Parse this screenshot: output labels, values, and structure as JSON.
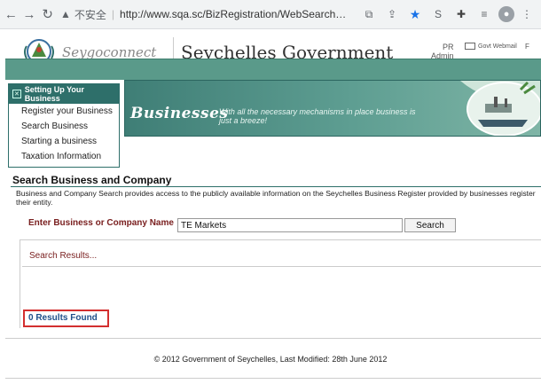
{
  "browser": {
    "insecure_label": "不安全",
    "url": "http://www.sqa.sc/BizRegistration/WebSearchBusi...",
    "icons": [
      "back-icon",
      "forward-icon",
      "reload-icon",
      "warning-icon",
      "translate-icon",
      "share-icon",
      "star-icon",
      "extension-icon",
      "puzzle-icon",
      "reading-list-icon",
      "profile-icon",
      "menu-icon"
    ],
    "back_glyph": "←",
    "forward_glyph": "→",
    "reload_glyph": "↻",
    "warning_glyph": "▲",
    "translate_glyph": "⧉",
    "share_glyph": "⇪",
    "star_glyph": "★",
    "ext_glyph": "S",
    "puzzle_glyph": "✚",
    "list_glyph": "≡",
    "profile_glyph": "●",
    "menu_glyph": "⋮",
    "star_color": "#1a73e8"
  },
  "header": {
    "logo_text": "Seygoconnect",
    "title": "Seychelles Government",
    "admin_top": "PR",
    "admin_label": "Admin",
    "mail_label": "Govt Webmail",
    "feed_label": "F"
  },
  "sidebar": {
    "heading": "Setting Up Your Business",
    "items": [
      {
        "label": "Register your Business"
      },
      {
        "label": "Search Business"
      },
      {
        "label": "Starting a business"
      },
      {
        "label": "Taxation Information"
      }
    ]
  },
  "banner": {
    "word": "Businesses",
    "tagline": "With all the necessary mechanisms in place business is just a breeze!"
  },
  "content": {
    "title": "Search Business and Company",
    "description": "Business and Company Search provides access to the publicly available information on the Seychelles Business Register provided by businesses register their entity.",
    "search_label": "Enter Business or Company Name",
    "search_value": "TE Markets",
    "search_button": "Search",
    "results_heading": "Search Results...",
    "results_found": "0 Results Found"
  },
  "footer": {
    "text": "© 2012 Government of Seychelles, Last Modified: 28th June 2012"
  },
  "colors": {
    "brand_green": "#2e6f6a",
    "label_red": "#7a2020",
    "result_blue": "#1f4f8a",
    "highlight_red": "#d32f2f"
  }
}
